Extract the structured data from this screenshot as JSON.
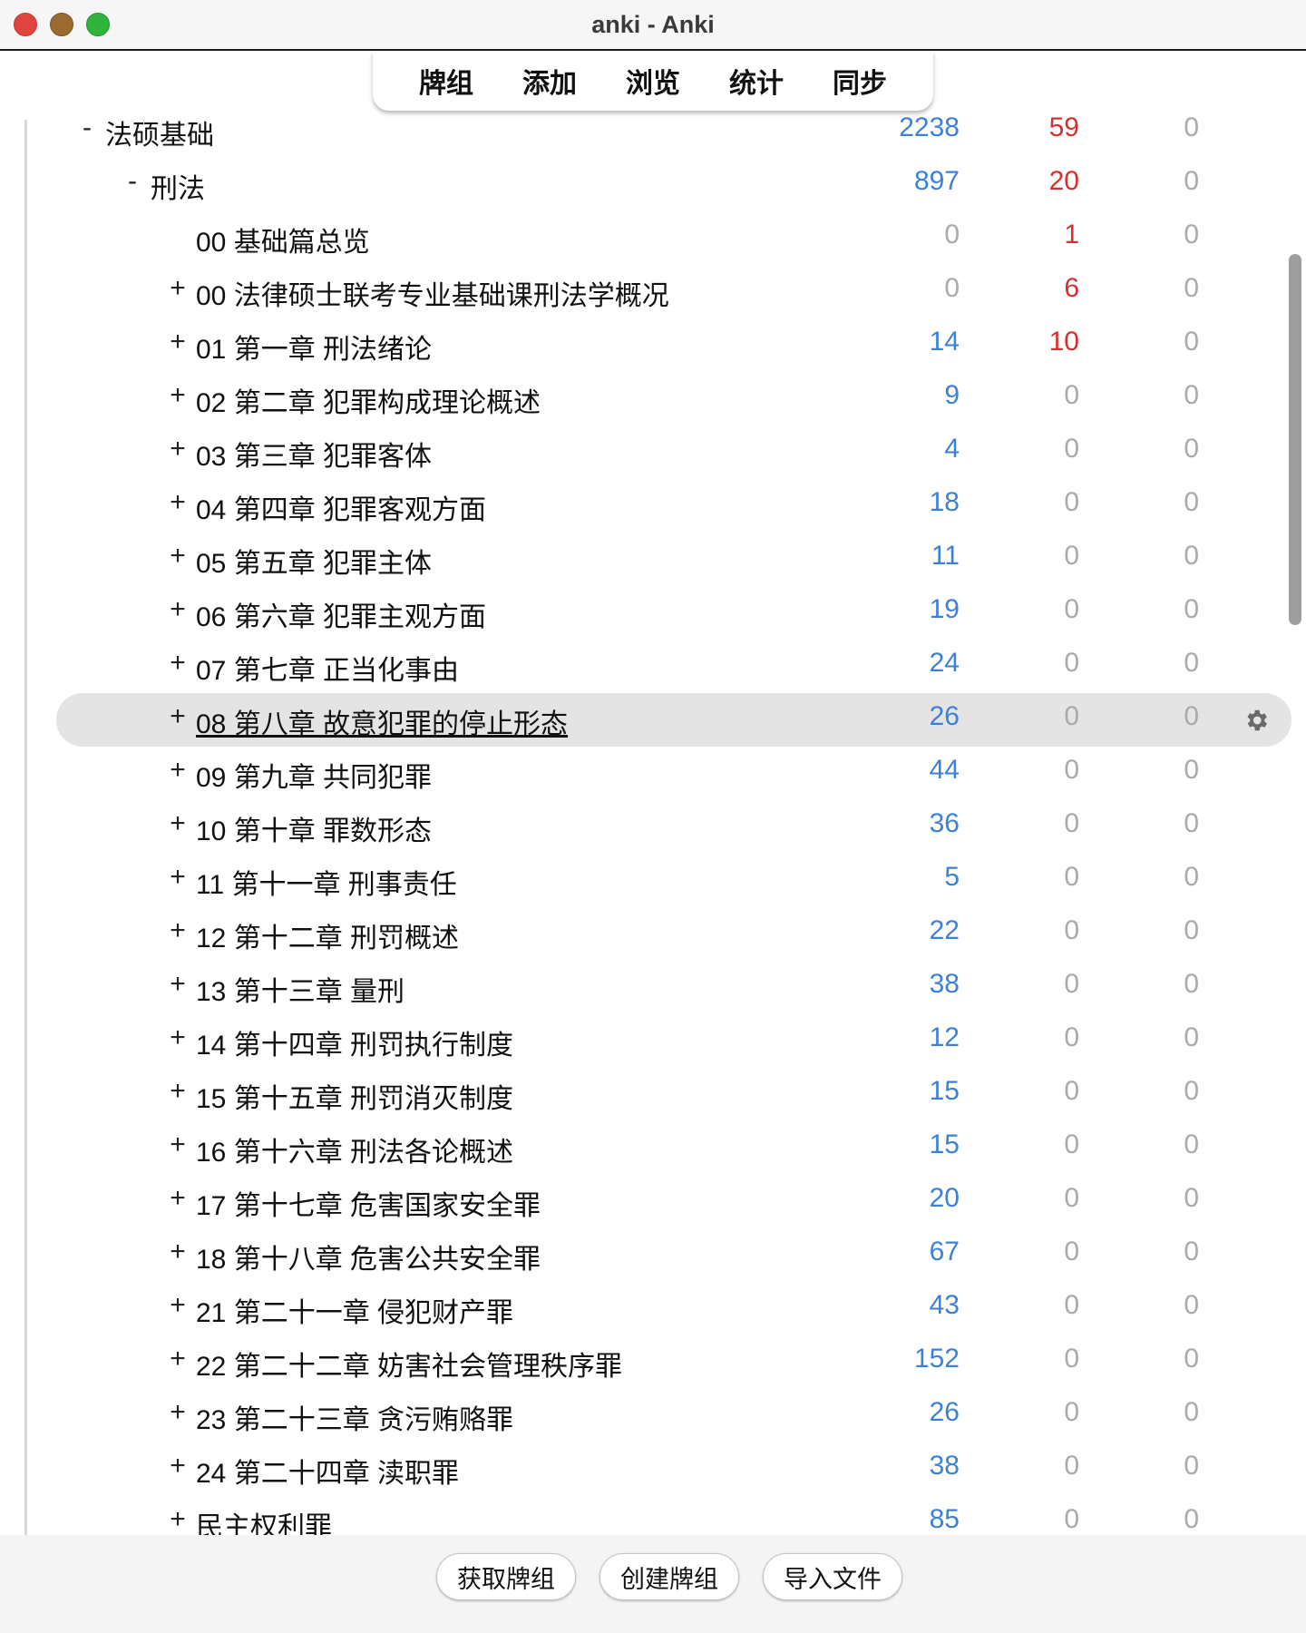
{
  "window": {
    "title": "anki - Anki"
  },
  "toolbar": {
    "tabs": [
      "牌组",
      "添加",
      "浏览",
      "统计",
      "同步"
    ]
  },
  "decks": [
    {
      "collapse": "-",
      "name": "法硕基础",
      "new": "2238",
      "learn": "59",
      "due": "0",
      "level": 0
    },
    {
      "collapse": "-",
      "name": "刑法",
      "new": "897",
      "learn": "20",
      "due": "0",
      "level": 1
    },
    {
      "collapse": "",
      "name": "00 基础篇总览",
      "new": "0",
      "learn": "1",
      "due": "0",
      "level": 2
    },
    {
      "collapse": "+",
      "name": "00 法律硕士联考专业基础课刑法学概况",
      "new": "0",
      "learn": "6",
      "due": "0",
      "level": 2
    },
    {
      "collapse": "+",
      "name": "01 第一章 刑法绪论",
      "new": "14",
      "learn": "10",
      "due": "0",
      "level": 2
    },
    {
      "collapse": "+",
      "name": "02 第二章 犯罪构成理论概述",
      "new": "9",
      "learn": "0",
      "due": "0",
      "level": 2
    },
    {
      "collapse": "+",
      "name": "03 第三章 犯罪客体",
      "new": "4",
      "learn": "0",
      "due": "0",
      "level": 2
    },
    {
      "collapse": "+",
      "name": "04 第四章 犯罪客观方面",
      "new": "18",
      "learn": "0",
      "due": "0",
      "level": 2
    },
    {
      "collapse": "+",
      "name": "05 第五章 犯罪主体",
      "new": "11",
      "learn": "0",
      "due": "0",
      "level": 2
    },
    {
      "collapse": "+",
      "name": "06 第六章 犯罪主观方面",
      "new": "19",
      "learn": "0",
      "due": "0",
      "level": 2
    },
    {
      "collapse": "+",
      "name": "07 第七章 正当化事由",
      "new": "24",
      "learn": "0",
      "due": "0",
      "level": 2
    },
    {
      "collapse": "+",
      "name": "08 第八章 故意犯罪的停止形态",
      "new": "26",
      "learn": "0",
      "due": "0",
      "level": 2,
      "current": true
    },
    {
      "collapse": "+",
      "name": "09 第九章 共同犯罪",
      "new": "44",
      "learn": "0",
      "due": "0",
      "level": 2
    },
    {
      "collapse": "+",
      "name": "10 第十章 罪数形态",
      "new": "36",
      "learn": "0",
      "due": "0",
      "level": 2
    },
    {
      "collapse": "+",
      "name": "11 第十一章 刑事责任",
      "new": "5",
      "learn": "0",
      "due": "0",
      "level": 2
    },
    {
      "collapse": "+",
      "name": "12 第十二章 刑罚概述",
      "new": "22",
      "learn": "0",
      "due": "0",
      "level": 2
    },
    {
      "collapse": "+",
      "name": "13 第十三章 量刑",
      "new": "38",
      "learn": "0",
      "due": "0",
      "level": 2
    },
    {
      "collapse": "+",
      "name": "14 第十四章 刑罚执行制度",
      "new": "12",
      "learn": "0",
      "due": "0",
      "level": 2
    },
    {
      "collapse": "+",
      "name": "15 第十五章 刑罚消灭制度",
      "new": "15",
      "learn": "0",
      "due": "0",
      "level": 2
    },
    {
      "collapse": "+",
      "name": "16 第十六章 刑法各论概述",
      "new": "15",
      "learn": "0",
      "due": "0",
      "level": 2
    },
    {
      "collapse": "+",
      "name": "17 第十七章 危害国家安全罪",
      "new": "20",
      "learn": "0",
      "due": "0",
      "level": 2
    },
    {
      "collapse": "+",
      "name": "18 第十八章 危害公共安全罪",
      "new": "67",
      "learn": "0",
      "due": "0",
      "level": 2
    },
    {
      "collapse": "+",
      "name": "21 第二十一章 侵犯财产罪",
      "new": "43",
      "learn": "0",
      "due": "0",
      "level": 2
    },
    {
      "collapse": "+",
      "name": "22 第二十二章 妨害社会管理秩序罪",
      "new": "152",
      "learn": "0",
      "due": "0",
      "level": 2
    },
    {
      "collapse": "+",
      "name": "23 第二十三章 贪污贿赂罪",
      "new": "26",
      "learn": "0",
      "due": "0",
      "level": 2
    },
    {
      "collapse": "+",
      "name": "24 第二十四章 渎职罪",
      "new": "38",
      "learn": "0",
      "due": "0",
      "level": 2
    },
    {
      "collapse": "+",
      "name": "民主权利罪",
      "new": "85",
      "learn": "0",
      "due": "0",
      "level": 2
    }
  ],
  "gear_icon": "gear-icon",
  "bottom": {
    "get_shared": "获取牌组",
    "create_deck": "创建牌组",
    "import_file": "导入文件"
  },
  "colors": {
    "new": "#3b82d6",
    "learn": "#d62f2f",
    "due": "#aaaaaa"
  }
}
